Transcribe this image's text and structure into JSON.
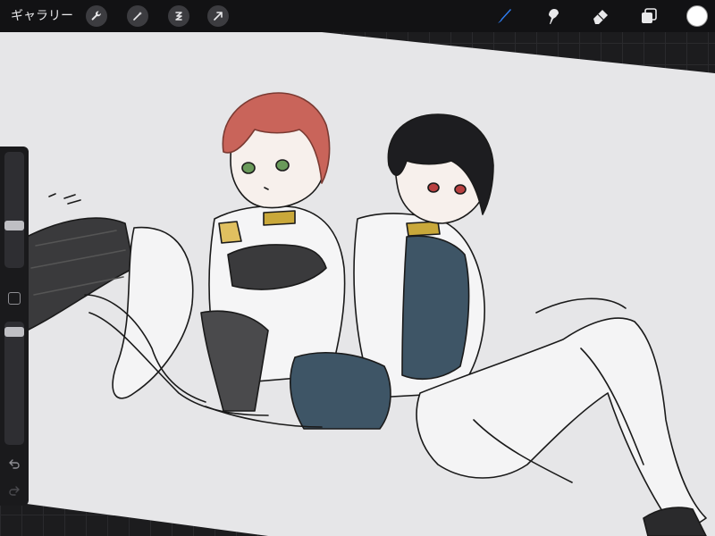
{
  "app": {
    "gallery_label": "ギャラリー"
  },
  "toolbar_left": [
    {
      "icon": "wrench-icon"
    },
    {
      "icon": "magic-wand-icon"
    },
    {
      "icon": "selection-icon"
    },
    {
      "icon": "transform-arrow-icon"
    }
  ],
  "toolbar_right": [
    {
      "icon": "brush-icon",
      "active": true
    },
    {
      "icon": "smudge-icon"
    },
    {
      "icon": "eraser-icon"
    },
    {
      "icon": "layers-icon"
    }
  ],
  "colors": {
    "accent": "#2f7ff5",
    "current_color": "#ffffff",
    "canvas": "#e6e6e8",
    "topbar": "#121214"
  },
  "sidebar": {
    "brush_size": 0.35,
    "brush_opacity": 0.95,
    "undo_icon": "undo-icon",
    "redo_icon": "redo-icon"
  }
}
